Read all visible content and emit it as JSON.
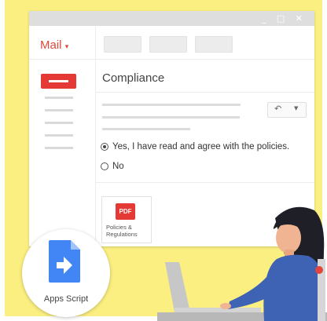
{
  "mail": {
    "app_label": "Mail",
    "dropdown_glyph": "▾",
    "window_controls": "_ □ ✕",
    "subject": "Compliance",
    "reply_glyph": "↶",
    "caret_glyph": "▼",
    "options": [
      {
        "label": "Yes, I have read and agree with the policies.",
        "selected": true
      },
      {
        "label": "No",
        "selected": false
      }
    ],
    "attachment": {
      "badge": "PDF",
      "name_line1": "Policies &",
      "name_line2": "Regulations"
    }
  },
  "apps_script": {
    "label": "Apps Script",
    "icon": "apps-script-icon"
  },
  "colors": {
    "accent_red": "#e53935",
    "background_yellow": "#fbef81",
    "apps_script_blue": "#4285f4"
  }
}
